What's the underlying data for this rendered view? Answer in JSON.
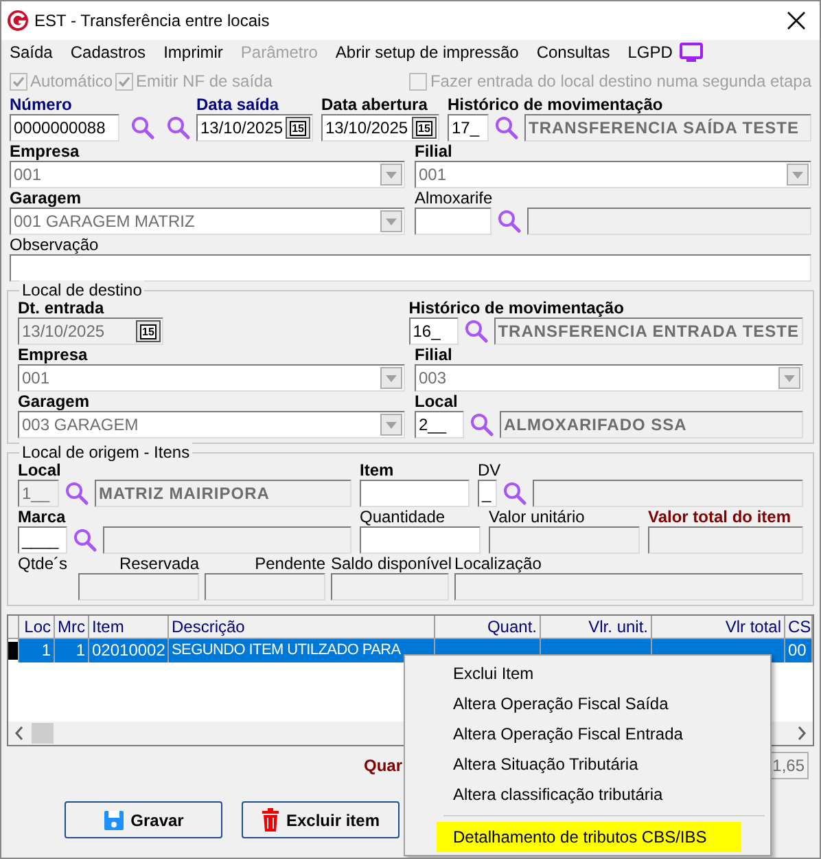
{
  "window": {
    "title": "EST - Transferência entre locais"
  },
  "menu": [
    {
      "label": "Saída",
      "disabled": false
    },
    {
      "label": "Cadastros",
      "disabled": false
    },
    {
      "label": "Imprimir",
      "disabled": false
    },
    {
      "label": "Parâmetro",
      "disabled": true
    },
    {
      "label": "Abrir setup de impressão",
      "disabled": false
    },
    {
      "label": "Consultas",
      "disabled": false
    },
    {
      "label": "LGPD",
      "disabled": false
    }
  ],
  "options": [
    {
      "label": "Automático",
      "checked": true,
      "disabled": true
    },
    {
      "label": "Emitir NF de saída",
      "checked": true,
      "disabled": true
    },
    {
      "label": "Fazer entrada do local destino numa segunda etapa",
      "checked": false,
      "disabled": true
    }
  ],
  "header": {
    "numero": {
      "label": "Número",
      "value": "0000000088"
    },
    "data_saida": {
      "label": "Data saída",
      "value": "13/10/2025",
      "calendar": "15"
    },
    "data_abertura": {
      "label": "Data abertura",
      "value": "13/10/2025",
      "calendar": "15"
    },
    "historico": {
      "label": "Histórico de movimentação",
      "code": "17_",
      "description": "TRANSFERENCIA SAÍDA TESTE"
    },
    "empresa": {
      "label": "Empresa",
      "value": "001"
    },
    "filial": {
      "label": "Filial",
      "value": "001"
    },
    "garagem": {
      "label": "Garagem",
      "value": "001 GARAGEM MATRIZ"
    },
    "almoxarife": {
      "label": "Almoxarife"
    },
    "observacao": {
      "label": "Observação"
    }
  },
  "destino": {
    "title": "Local de destino",
    "dt_entrada": {
      "label": "Dt. entrada",
      "value": "13/10/2025",
      "calendar": "15"
    },
    "historico": {
      "label": "Histórico de movimentação",
      "code": "16_",
      "description": "TRANSFERENCIA ENTRADA TESTE"
    },
    "empresa": {
      "label": "Empresa",
      "value": "001"
    },
    "filial": {
      "label": "Filial",
      "value": "003"
    },
    "garagem": {
      "label": "Garagem",
      "value": "003 GARAGEM"
    },
    "local": {
      "label": "Local",
      "code": "2__",
      "description": "ALMOXARIFADO SSA"
    }
  },
  "origem": {
    "title": "Local de origem - Itens",
    "local": {
      "label": "Local",
      "code": "1__",
      "description": "MATRIZ MAIRIPORA"
    },
    "item": {
      "label": "Item"
    },
    "dv": {
      "label": "DV",
      "value": "_"
    },
    "marca": {
      "label": "Marca",
      "value": "____"
    },
    "quantidade": {
      "label": "Quantidade"
    },
    "valor_unitario": {
      "label": "Valor unitário"
    },
    "valor_total": {
      "label": "Valor total do item"
    },
    "qtdes": {
      "label": "Qtde´s"
    },
    "reservada": {
      "label": "Reservada"
    },
    "pendente": {
      "label": "Pendente"
    },
    "saldo": {
      "label": "Saldo disponível"
    },
    "localizacao": {
      "label": "Localização"
    }
  },
  "grid": {
    "columns": [
      "Loc",
      "Mrc",
      "Item",
      "Descrição",
      "Quant.",
      "Vlr. unit.",
      "Vlr total",
      "CS"
    ],
    "rows": [
      {
        "selected": true,
        "loc": "1",
        "mrc": "1",
        "item": "02010002",
        "descricao": "SEGUNDO ITEM UTILZADO PARA",
        "cs": "00"
      }
    ]
  },
  "totals": {
    "label": "Quar",
    "value": "1,65"
  },
  "buttons": [
    {
      "label": "Gravar",
      "kind": "save"
    },
    {
      "label": "Excluir item",
      "kind": "delete"
    }
  ],
  "context_menu": [
    {
      "label": "Exclui Item",
      "highlighted": false,
      "separator_before": false
    },
    {
      "label": "Altera Operação Fiscal Saída",
      "highlighted": false,
      "separator_before": false
    },
    {
      "label": "Altera Operação Fiscal Entrada",
      "highlighted": false,
      "separator_before": false
    },
    {
      "label": "Altera Situação Tributária",
      "highlighted": false,
      "separator_before": false
    },
    {
      "label": "Altera classificação tributária",
      "highlighted": false,
      "separator_before": false
    },
    {
      "label": "Detalhamento de tributos CBS/IBS",
      "highlighted": true,
      "separator_before": true
    }
  ]
}
